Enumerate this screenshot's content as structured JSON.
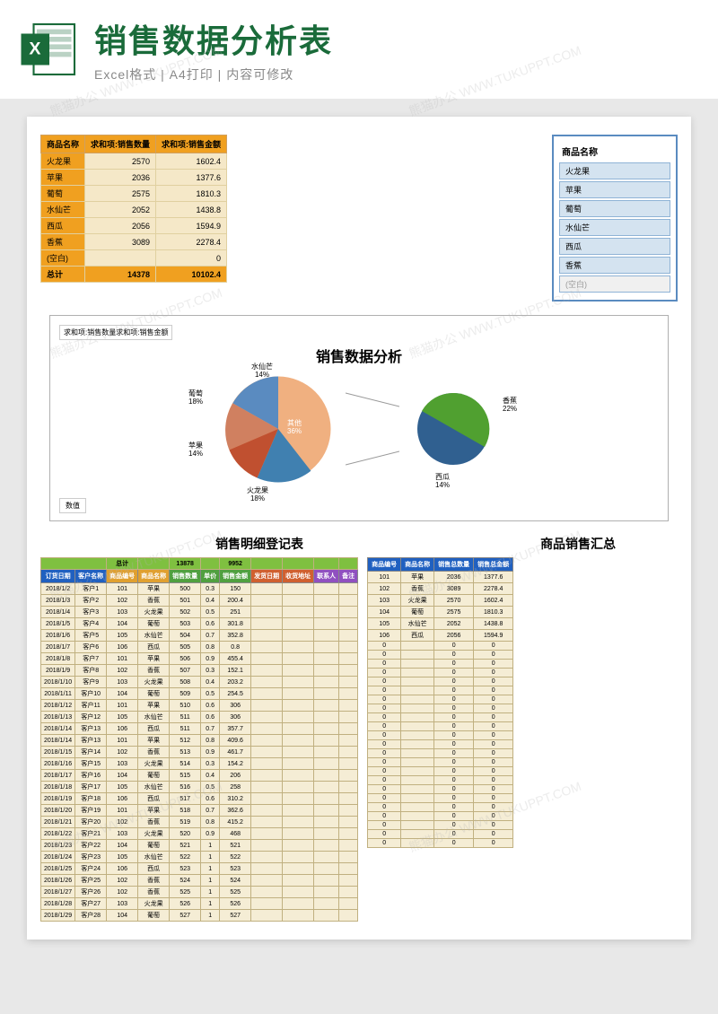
{
  "header": {
    "title": "销售数据分析表",
    "subtitle": "Excel格式 | A4打印 | 内容可修改"
  },
  "pivot": {
    "headers": [
      "商品名称",
      "求和项:销售数量",
      "求和项:销售金额"
    ],
    "rows": [
      {
        "name": "火龙果",
        "qty": 2570,
        "amt": "1602.4"
      },
      {
        "name": "苹果",
        "qty": 2036,
        "amt": "1377.6"
      },
      {
        "name": "葡萄",
        "qty": 2575,
        "amt": "1810.3"
      },
      {
        "name": "水仙芒",
        "qty": 2052,
        "amt": "1438.8"
      },
      {
        "name": "西瓜",
        "qty": 2056,
        "amt": "1594.9"
      },
      {
        "name": "香蕉",
        "qty": 3089,
        "amt": "2278.4"
      },
      {
        "name": "(空白)",
        "qty": "",
        "amt": "0"
      }
    ],
    "total": {
      "name": "总计",
      "qty": 14378,
      "amt": "10102.4"
    }
  },
  "slicer": {
    "title": "商品名称",
    "items": [
      "火龙果",
      "苹果",
      "葡萄",
      "水仙芒",
      "西瓜",
      "香蕉"
    ],
    "blank": "(空白)"
  },
  "chart_data": {
    "type": "pie",
    "title": "销售数据分析",
    "legend_top": "求和项:销售数量求和项:销售金额",
    "data_label": "数值",
    "series": [
      {
        "name": "主饼图",
        "slices": [
          {
            "label": "水仙芒",
            "pct": 14,
            "color": "#5a8bc0"
          },
          {
            "label": "葡萄",
            "pct": 18,
            "color": "#d08060"
          },
          {
            "label": "苹果",
            "pct": 14,
            "color": "#c05030"
          },
          {
            "label": "火龙果",
            "pct": 18,
            "color": "#4080b0"
          },
          {
            "label": "其他",
            "pct": 36,
            "color": "#f0b080"
          }
        ]
      },
      {
        "name": "子饼图",
        "slices": [
          {
            "label": "香蕉",
            "pct": 22,
            "color": "#50a030"
          },
          {
            "label": "西瓜",
            "pct": 14,
            "color": "#306090"
          }
        ]
      }
    ]
  },
  "detail": {
    "title": "销售明细登记表",
    "total_label": "总计",
    "total_qty": 13878,
    "total_amt": 9952,
    "headers": [
      "订货日期",
      "客户名称",
      "商品编号",
      "商品名称",
      "销售数量",
      "单价",
      "销售金额",
      "发货日期",
      "收货地址",
      "联系人",
      "备注"
    ],
    "header_colors": [
      "#2060c0",
      "#2060c0",
      "#e0a030",
      "#e0a030",
      "#50a040",
      "#50a040",
      "#50a040",
      "#d06030",
      "#d06030",
      "#9050c0",
      "#9050c0"
    ],
    "rows": [
      [
        "2018/1/2",
        "客户1",
        "101",
        "苹果",
        "500",
        "0.3",
        "150",
        "",
        "",
        "",
        ""
      ],
      [
        "2018/1/3",
        "客户2",
        "102",
        "香蕉",
        "501",
        "0.4",
        "200.4",
        "",
        "",
        "",
        ""
      ],
      [
        "2018/1/4",
        "客户3",
        "103",
        "火龙果",
        "502",
        "0.5",
        "251",
        "",
        "",
        "",
        ""
      ],
      [
        "2018/1/5",
        "客户4",
        "104",
        "葡萄",
        "503",
        "0.6",
        "301.8",
        "",
        "",
        "",
        ""
      ],
      [
        "2018/1/6",
        "客户5",
        "105",
        "水仙芒",
        "504",
        "0.7",
        "352.8",
        "",
        "",
        "",
        ""
      ],
      [
        "2018/1/7",
        "客户6",
        "106",
        "西瓜",
        "505",
        "0.8",
        "0.8",
        "",
        "",
        "",
        ""
      ],
      [
        "2018/1/8",
        "客户7",
        "101",
        "苹果",
        "506",
        "0.9",
        "455.4",
        "",
        "",
        "",
        ""
      ],
      [
        "2018/1/9",
        "客户8",
        "102",
        "香蕉",
        "507",
        "0.3",
        "152.1",
        "",
        "",
        "",
        ""
      ],
      [
        "2018/1/10",
        "客户9",
        "103",
        "火龙果",
        "508",
        "0.4",
        "203.2",
        "",
        "",
        "",
        ""
      ],
      [
        "2018/1/11",
        "客户10",
        "104",
        "葡萄",
        "509",
        "0.5",
        "254.5",
        "",
        "",
        "",
        ""
      ],
      [
        "2018/1/12",
        "客户11",
        "101",
        "苹果",
        "510",
        "0.6",
        "306",
        "",
        "",
        "",
        ""
      ],
      [
        "2018/1/13",
        "客户12",
        "105",
        "水仙芒",
        "511",
        "0.6",
        "306",
        "",
        "",
        "",
        ""
      ],
      [
        "2018/1/14",
        "客户13",
        "106",
        "西瓜",
        "511",
        "0.7",
        "357.7",
        "",
        "",
        "",
        ""
      ],
      [
        "2018/1/14",
        "客户13",
        "101",
        "苹果",
        "512",
        "0.8",
        "409.6",
        "",
        "",
        "",
        ""
      ],
      [
        "2018/1/15",
        "客户14",
        "102",
        "香蕉",
        "513",
        "0.9",
        "461.7",
        "",
        "",
        "",
        ""
      ],
      [
        "2018/1/16",
        "客户15",
        "103",
        "火龙果",
        "514",
        "0.3",
        "154.2",
        "",
        "",
        "",
        ""
      ],
      [
        "2018/1/17",
        "客户16",
        "104",
        "葡萄",
        "515",
        "0.4",
        "206",
        "",
        "",
        "",
        ""
      ],
      [
        "2018/1/18",
        "客户17",
        "105",
        "水仙芒",
        "516",
        "0.5",
        "258",
        "",
        "",
        "",
        ""
      ],
      [
        "2018/1/19",
        "客户18",
        "106",
        "西瓜",
        "517",
        "0.6",
        "310.2",
        "",
        "",
        "",
        ""
      ],
      [
        "2018/1/20",
        "客户19",
        "101",
        "苹果",
        "518",
        "0.7",
        "362.6",
        "",
        "",
        "",
        ""
      ],
      [
        "2018/1/21",
        "客户20",
        "102",
        "香蕉",
        "519",
        "0.8",
        "415.2",
        "",
        "",
        "",
        ""
      ],
      [
        "2018/1/22",
        "客户21",
        "103",
        "火龙果",
        "520",
        "0.9",
        "468",
        "",
        "",
        "",
        ""
      ],
      [
        "2018/1/23",
        "客户22",
        "104",
        "葡萄",
        "521",
        "1",
        "521",
        "",
        "",
        "",
        ""
      ],
      [
        "2018/1/24",
        "客户23",
        "105",
        "水仙芒",
        "522",
        "1",
        "522",
        "",
        "",
        "",
        ""
      ],
      [
        "2018/1/25",
        "客户24",
        "106",
        "西瓜",
        "523",
        "1",
        "523",
        "",
        "",
        "",
        ""
      ],
      [
        "2018/1/26",
        "客户25",
        "102",
        "香蕉",
        "524",
        "1",
        "524",
        "",
        "",
        "",
        ""
      ],
      [
        "2018/1/27",
        "客户26",
        "102",
        "香蕉",
        "525",
        "1",
        "525",
        "",
        "",
        "",
        ""
      ],
      [
        "2018/1/28",
        "客户27",
        "103",
        "火龙果",
        "526",
        "1",
        "526",
        "",
        "",
        "",
        ""
      ],
      [
        "2018/1/29",
        "客户28",
        "104",
        "葡萄",
        "527",
        "1",
        "527",
        "",
        "",
        "",
        ""
      ]
    ]
  },
  "summary": {
    "title": "商品销售汇总",
    "headers": [
      "商品编号",
      "商品名称",
      "销售总数量",
      "销售总金额"
    ],
    "rows": [
      [
        "101",
        "苹果",
        "2036",
        "1377.6"
      ],
      [
        "102",
        "香蕉",
        "3089",
        "2278.4"
      ],
      [
        "103",
        "火龙果",
        "2570",
        "1602.4"
      ],
      [
        "104",
        "葡萄",
        "2575",
        "1810.3"
      ],
      [
        "105",
        "水仙芒",
        "2052",
        "1438.8"
      ],
      [
        "106",
        "西瓜",
        "2056",
        "1594.9"
      ],
      [
        "0",
        "",
        "0",
        "0"
      ],
      [
        "0",
        "",
        "0",
        "0"
      ],
      [
        "0",
        "",
        "0",
        "0"
      ],
      [
        "0",
        "",
        "0",
        "0"
      ],
      [
        "0",
        "",
        "0",
        "0"
      ],
      [
        "0",
        "",
        "0",
        "0"
      ],
      [
        "0",
        "",
        "0",
        "0"
      ],
      [
        "0",
        "",
        "0",
        "0"
      ],
      [
        "0",
        "",
        "0",
        "0"
      ],
      [
        "0",
        "",
        "0",
        "0"
      ],
      [
        "0",
        "",
        "0",
        "0"
      ],
      [
        "0",
        "",
        "0",
        "0"
      ],
      [
        "0",
        "",
        "0",
        "0"
      ],
      [
        "0",
        "",
        "0",
        "0"
      ],
      [
        "0",
        "",
        "0",
        "0"
      ],
      [
        "0",
        "",
        "0",
        "0"
      ],
      [
        "0",
        "",
        "0",
        "0"
      ],
      [
        "0",
        "",
        "0",
        "0"
      ],
      [
        "0",
        "",
        "0",
        "0"
      ],
      [
        "0",
        "",
        "0",
        "0"
      ],
      [
        "0",
        "",
        "0",
        "0"
      ],
      [
        "0",
        "",
        "0",
        "0"
      ],
      [
        "0",
        "",
        "0",
        "0"
      ]
    ]
  },
  "watermark": "熊猫办公 WWW.TUKUPPT.COM"
}
